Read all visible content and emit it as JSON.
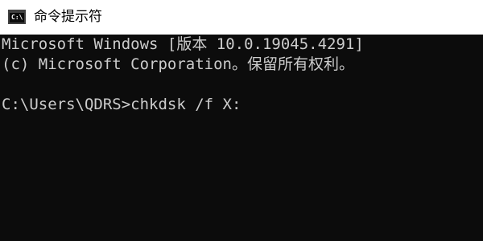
{
  "window": {
    "title": "命令提示符",
    "icon": "command-prompt-icon",
    "icon_glyph": "C:\\"
  },
  "console": {
    "lines": [
      "Microsoft Windows [版本 10.0.19045.4291]",
      "(c) Microsoft Corporation。保留所有权利。",
      "",
      "C:\\Users\\QDRS>chkdsk /f X:"
    ],
    "text_color": "#cccccc",
    "background_color": "#0c0c0c"
  }
}
